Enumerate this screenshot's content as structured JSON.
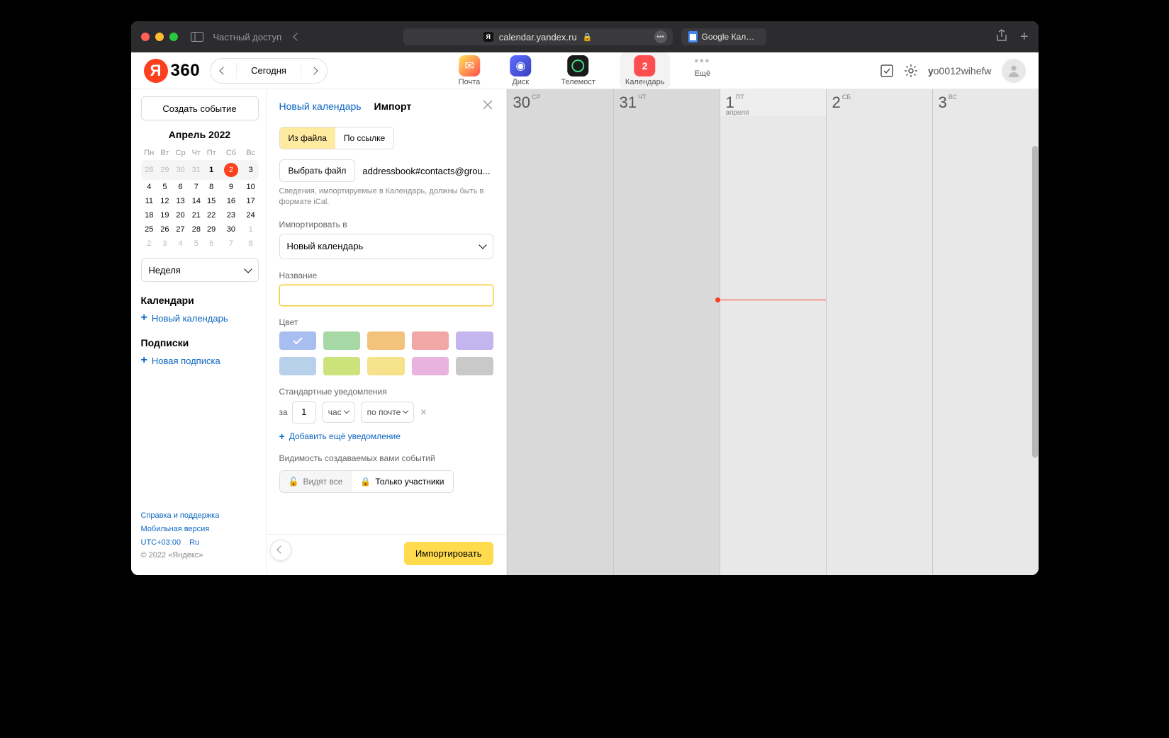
{
  "titlebar": {
    "mode_label": "Частный доступ",
    "url": "calendar.yandex.ru",
    "bg_tab": "Google Календа..."
  },
  "header": {
    "logo_text": "360",
    "today": "Сегодня",
    "services": {
      "mail": "Почта",
      "disk": "Диск",
      "telemost": "Телемост",
      "calendar": "Календарь",
      "calendar_badge": "2",
      "more": "Ещё"
    },
    "username": "yo0012wihefw"
  },
  "sidebar": {
    "create": "Создать событие",
    "month_title": "Апрель 2022",
    "weekdays": [
      "Пн",
      "Вт",
      "Ср",
      "Чт",
      "Пт",
      "Сб",
      "Вс"
    ],
    "weeks": [
      [
        {
          "d": "28",
          "o": true
        },
        {
          "d": "29",
          "o": true
        },
        {
          "d": "30",
          "o": true
        },
        {
          "d": "31",
          "o": true
        },
        {
          "d": "1",
          "today": true
        },
        {
          "d": "2",
          "sel": true
        },
        {
          "d": "3"
        }
      ],
      [
        {
          "d": "4"
        },
        {
          "d": "5"
        },
        {
          "d": "6"
        },
        {
          "d": "7"
        },
        {
          "d": "8"
        },
        {
          "d": "9"
        },
        {
          "d": "10"
        }
      ],
      [
        {
          "d": "11"
        },
        {
          "d": "12"
        },
        {
          "d": "13"
        },
        {
          "d": "14"
        },
        {
          "d": "15"
        },
        {
          "d": "16"
        },
        {
          "d": "17"
        }
      ],
      [
        {
          "d": "18"
        },
        {
          "d": "19"
        },
        {
          "d": "20"
        },
        {
          "d": "21"
        },
        {
          "d": "22"
        },
        {
          "d": "23"
        },
        {
          "d": "24"
        }
      ],
      [
        {
          "d": "25"
        },
        {
          "d": "26"
        },
        {
          "d": "27"
        },
        {
          "d": "28"
        },
        {
          "d": "29"
        },
        {
          "d": "30"
        },
        {
          "d": "1",
          "o": true
        }
      ],
      [
        {
          "d": "2",
          "o": true
        },
        {
          "d": "3",
          "o": true
        },
        {
          "d": "4",
          "o": true
        },
        {
          "d": "5",
          "o": true
        },
        {
          "d": "6",
          "o": true
        },
        {
          "d": "7",
          "o": true
        },
        {
          "d": "8",
          "o": true
        }
      ]
    ],
    "view": "Неделя",
    "calendars_heading": "Календари",
    "new_calendar": "Новый календарь",
    "subs_heading": "Подписки",
    "new_sub": "Новая подписка",
    "footer": {
      "help": "Справка и поддержка",
      "mobile": "Мобильная версия",
      "tz": "UTC+03:00",
      "lang": "Ru",
      "copy": "© 2022 «Яндекс»"
    }
  },
  "panel": {
    "tab_new": "Новый календарь",
    "tab_import": "Импорт",
    "seg_file": "Из файла",
    "seg_url": "По ссылке",
    "file_button": "Выбрать файл",
    "file_name": "addressbook#contacts@grou...",
    "file_hint": "Сведения, импортируемые в Календарь, должны быть в формате iCal.",
    "import_to_label": "Импортировать в",
    "import_to_value": "Новый календарь",
    "name_label": "Название",
    "name_value": "",
    "color_label": "Цвет",
    "colors": [
      "#a8bdf0",
      "#a6d8a6",
      "#f4c37b",
      "#f2a7a7",
      "#c3b6ef",
      "#b8d0ea",
      "#cce27a",
      "#f5e28a",
      "#e9b3df",
      "#c9c9c9"
    ],
    "selected_color_index": 0,
    "notif_label": "Стандартные уведомления",
    "notif_za": "за",
    "notif_value": "1",
    "notif_unit": "час",
    "notif_method": "по почте",
    "add_notif": "Добавить ещё уведомление",
    "visibility_label": "Видимость создаваемых вами событий",
    "vis_all": "Видят все",
    "vis_participants": "Только участники",
    "submit": "Импортировать"
  },
  "grid": {
    "days": [
      {
        "num": "30",
        "wd": "СР"
      },
      {
        "num": "31",
        "wd": "ЧТ"
      },
      {
        "num": "1",
        "wd": "ПТ",
        "mo": "апреля",
        "hl": true
      },
      {
        "num": "2",
        "wd": "СБ"
      },
      {
        "num": "3",
        "wd": "ВС"
      }
    ]
  }
}
